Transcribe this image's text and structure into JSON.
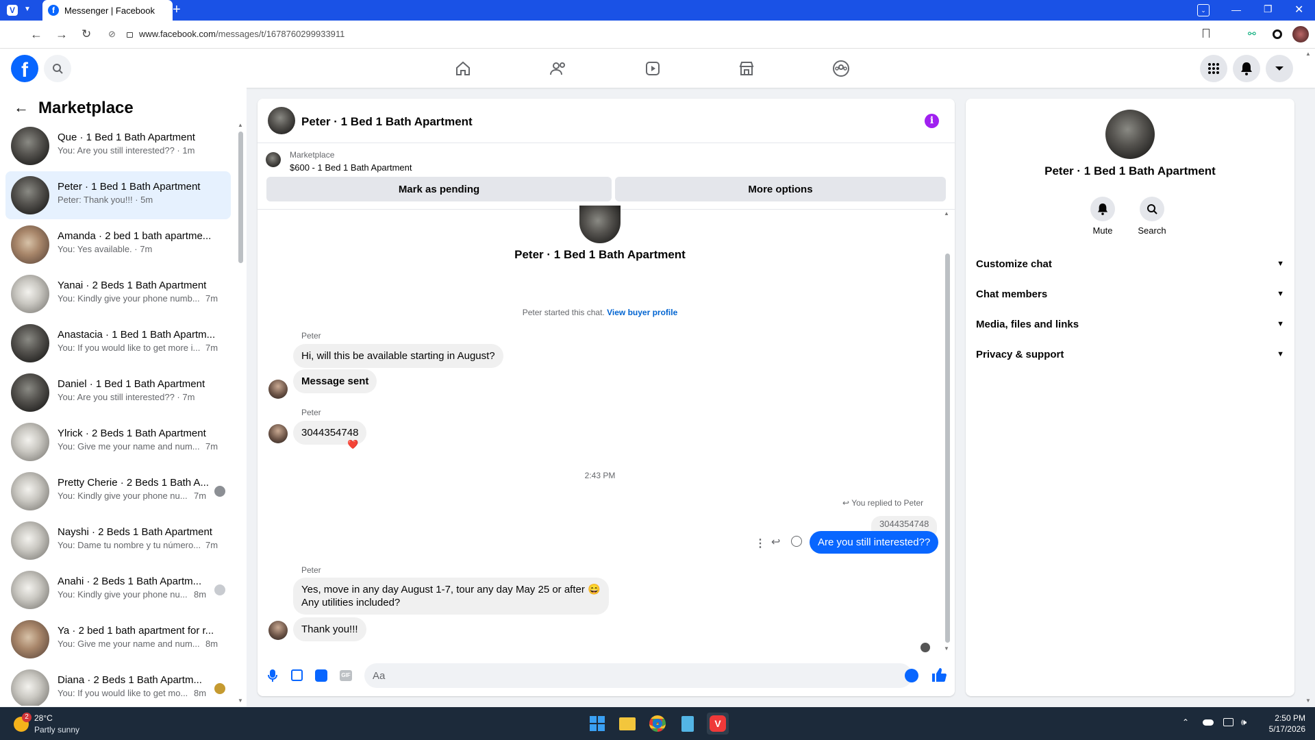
{
  "browser": {
    "tab_title": "Messenger | Facebook",
    "url_host": "www.facebook.com",
    "url_path": "/messages/t/1678760299933911"
  },
  "left_panel": {
    "title": "Marketplace",
    "conversations": [
      {
        "name": "Que · 1 Bed 1 Bath Apartment",
        "preview": "You: Are you still interested?? · 1m",
        "time": ""
      },
      {
        "name": "Peter · 1 Bed 1 Bath Apartment",
        "preview": "Peter: Thank you!!! · 5m",
        "time": ""
      },
      {
        "name": "Amanda · 2 bed 1 bath apartme...",
        "preview": "You: Yes available. · 7m",
        "time": ""
      },
      {
        "name": "Yanai · 2 Beds 1 Bath Apartment",
        "preview": "You: Kindly give your phone numb...",
        "time": "7m"
      },
      {
        "name": "Anastacia · 1 Bed 1 Bath Apartm...",
        "preview": "You: If you would like to get more i...",
        "time": "7m"
      },
      {
        "name": "Daniel · 1 Bed 1 Bath Apartment",
        "preview": "You: Are you still interested?? · 7m",
        "time": ""
      },
      {
        "name": "Ylrick · 2 Beds 1 Bath Apartment",
        "preview": "You: Give me your name and num...",
        "time": "7m"
      },
      {
        "name": "Pretty Cherie · 2 Beds 1 Bath A...",
        "preview": "You: Kindly give your phone nu...",
        "time": "7m"
      },
      {
        "name": "Nayshi · 2 Beds 1 Bath Apartment",
        "preview": "You: Dame tu nombre y tu número...",
        "time": "7m"
      },
      {
        "name": "Anahi · 2 Beds 1 Bath Apartm...",
        "preview": "You: Kindly give your phone nu...",
        "time": "8m"
      },
      {
        "name": "Ya · 2 bed 1 bath apartment for r...",
        "preview": "You: Give me your name and num...",
        "time": "8m"
      },
      {
        "name": "Diana · 2 Beds 1 Bath Apartm...",
        "preview": "You: If you would like to get mo...",
        "time": "8m"
      }
    ]
  },
  "chat": {
    "header_title": "Peter · 1 Bed 1 Bath Apartment",
    "listing_label": "Marketplace",
    "listing_title": "$600 - 1 Bed 1 Bath Apartment",
    "mark_pending": "Mark as pending",
    "more_options": "More options",
    "profile_name": "Peter · 1 Bed 1 Bath Apartment",
    "started_text": "Peter started this chat.",
    "view_profile": "View buyer profile",
    "sender_1": "Peter",
    "msg_1": "Hi, will this be available starting in August?",
    "msg_2": "Message sent",
    "sender_2": "Peter",
    "msg_3": "3044354748",
    "reaction": "❤️",
    "timestamp": "2:43 PM",
    "replied_label": "You replied to Peter",
    "quoted": "3044354748",
    "my_msg": "Are you still interested??",
    "sender_3": "Peter",
    "msg_4_line1": "Yes, move in any day August 1-7, tour any day May 25 or after 😄",
    "msg_4_line2": "Any utilities included?",
    "msg_5": "Thank you!!!",
    "input_placeholder": "Aa"
  },
  "right_panel": {
    "name": "Peter · 1 Bed 1 Bath Apartment",
    "mute_label": "Mute",
    "search_label": "Search",
    "sections": [
      "Customize chat",
      "Chat members",
      "Media, files and links",
      "Privacy & support"
    ]
  },
  "taskbar": {
    "weather_temp": "28°C",
    "weather_desc": "Partly sunny",
    "weather_badge": "2",
    "time": "2:50 PM",
    "date": "5/17/2026"
  },
  "colors": {
    "accent": "#0866ff",
    "browser_bar": "#1a52e6",
    "info_icon": "#a020f0"
  }
}
